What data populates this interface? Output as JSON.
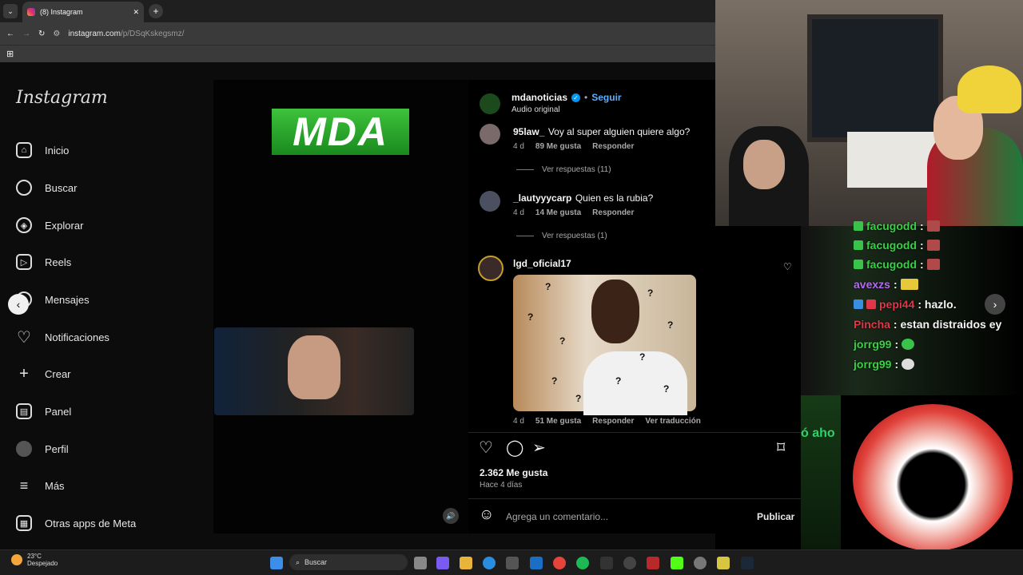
{
  "browser": {
    "tab_title": "(8) Instagram",
    "url_domain": "instagram.com",
    "url_path": "/p/DSqKskegsmz/"
  },
  "instagram": {
    "logo": "Instagram",
    "nav": [
      "Inicio",
      "Buscar",
      "Explorar",
      "Reels",
      "Mensajes",
      "Notificaciones",
      "Crear",
      "Panel",
      "Perfil",
      "Más",
      "Otras apps de Meta"
    ],
    "video_logo": "MDA",
    "post": {
      "author": "mdanoticias",
      "follow": "Seguir",
      "audio": "Audio original",
      "likes": "2.362 Me gusta",
      "time": "Hace 4 días",
      "comment_placeholder": "Agrega un comentario...",
      "publish": "Publicar"
    },
    "comments": [
      {
        "user": "95law_",
        "text": "Voy al super alguien quiere algo?",
        "age": "4 d",
        "likes": "89 Me gusta",
        "reply": "Responder",
        "view": "Ver respuestas (11)"
      },
      {
        "user": "_lautyyycarp",
        "text": "Quien es la rubia?",
        "age": "4 d",
        "likes": "14 Me gusta",
        "reply": "Responder",
        "view": "Ver respuestas (1)"
      },
      {
        "user": "lgd_oficial17",
        "age": "4 d",
        "likes": "51 Me gusta",
        "reply": "Responder",
        "translate": "Ver traducción"
      }
    ]
  },
  "chat": [
    {
      "user": "facugodd",
      "text": ":",
      "color": "#38d146"
    },
    {
      "user": "facugodd",
      "text": ":",
      "color": "#38d146"
    },
    {
      "user": "facugodd",
      "text": ":",
      "color": "#38d146"
    },
    {
      "user": "avexzs",
      "text": ":",
      "color": "#b36cf0"
    },
    {
      "user": "pepi44",
      "text": ": hazlo.",
      "color": "#e0364a"
    },
    {
      "user": "Pincha",
      "text": ": estan distraidos ey",
      "color": "#e0364a"
    },
    {
      "user": "jorrg99",
      "text": ":",
      "color": "#38d146"
    },
    {
      "user": "jorrg99",
      "text": ":",
      "color": "#38d146"
    }
  ],
  "overlay_text": "ó aho",
  "taskbar": {
    "temp": "23°C",
    "weather": "Despejado",
    "search": "Buscar"
  }
}
